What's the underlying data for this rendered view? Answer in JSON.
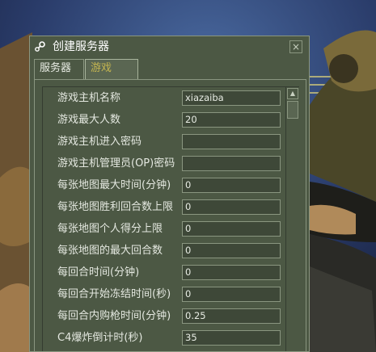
{
  "window": {
    "title": "创建服务器",
    "close_glyph": "×"
  },
  "tabs": [
    {
      "label": "服务器",
      "active": false
    },
    {
      "label": "游戏",
      "active": true
    }
  ],
  "settings": [
    {
      "label": "游戏主机名称",
      "value": "xiazaiba"
    },
    {
      "label": "游戏最大人数",
      "value": "20"
    },
    {
      "label": "游戏主机进入密码",
      "value": ""
    },
    {
      "label": "游戏主机管理员(OP)密码",
      "value": ""
    },
    {
      "label": "每张地图最大时间(分钟)",
      "value": "0"
    },
    {
      "label": "每张地图胜利回合数上限",
      "value": "0"
    },
    {
      "label": "每张地图个人得分上限",
      "value": "0"
    },
    {
      "label": "每张地图的最大回合数",
      "value": "0"
    },
    {
      "label": "每回合时间(分钟)",
      "value": "0"
    },
    {
      "label": "每回合开始冻结时间(秒)",
      "value": "0"
    },
    {
      "label": "每回合内购枪时间(分钟)",
      "value": "0.25"
    },
    {
      "label": "C4爆炸倒计时(秒)",
      "value": "35"
    }
  ],
  "colors": {
    "dialog_bg": "#4c5844",
    "active_tab_text": "#c4b550",
    "text": "#e4e8e0"
  },
  "icons": {
    "app": "steam-icon",
    "close": "close-icon",
    "scroll_up": "scroll-up-arrow-icon"
  }
}
